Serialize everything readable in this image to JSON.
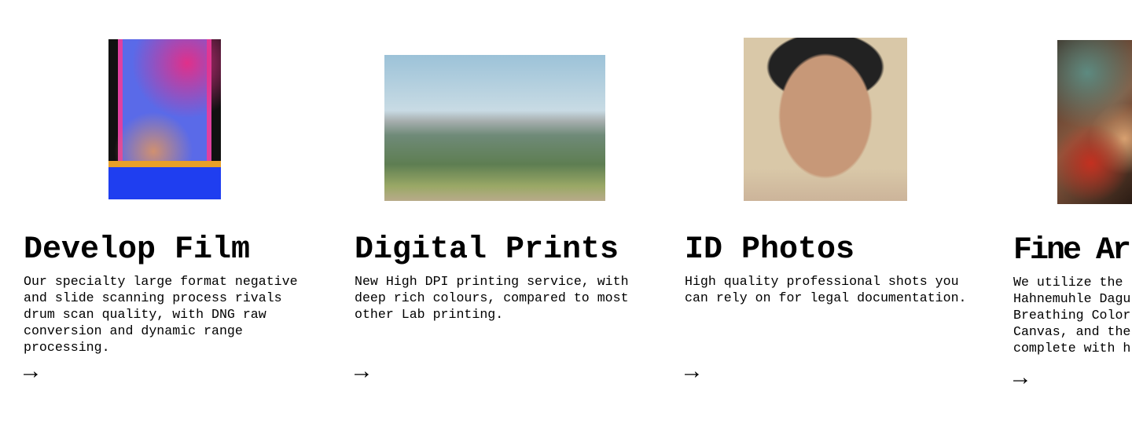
{
  "services": [
    {
      "title": "Develop Film",
      "description": "Our specialty large format negative\nand slide scanning process rivals\ndrum scan quality, with DNG raw\nconversion and dynamic range\nprocessing.",
      "arrow": "→",
      "image": "film-strip-scan"
    },
    {
      "title": "Digital Prints",
      "description": "New High DPI printing service, with\ndeep rich colours, compared to most\nother Lab printing.",
      "arrow": "→",
      "image": "mountain-landscape"
    },
    {
      "title": "ID Photos",
      "description": "High quality professional shots you\ncan rely on for legal documentation.",
      "arrow": "→",
      "image": "portrait"
    },
    {
      "title": "Fine Ar",
      "description": "We utilize the \nHahnemuhle Dagu\nBreathing Color\nCanvas, and the\ncomplete with h",
      "arrow": "→",
      "image": "flower-market"
    }
  ]
}
